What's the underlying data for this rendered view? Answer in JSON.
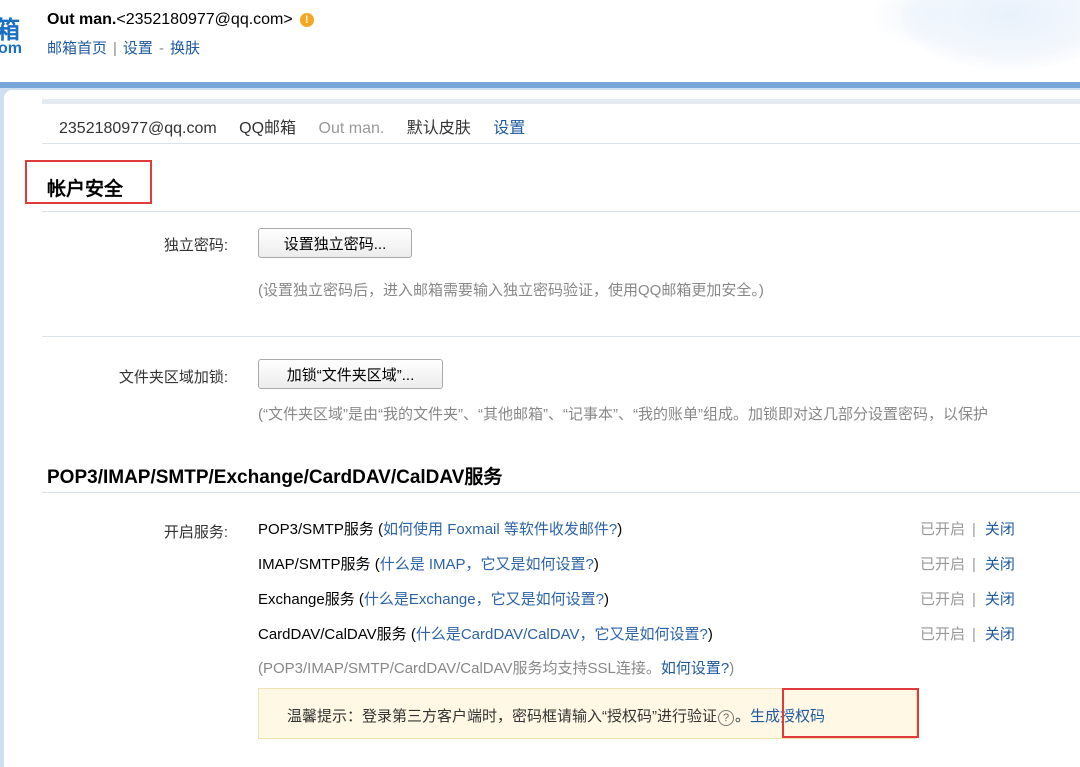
{
  "header": {
    "logo_char": "箱",
    "logo_suffix": "om",
    "user_name": "Out man.",
    "user_email": "<2352180977@qq.com>",
    "warning_icon": "!",
    "links": [
      "邮箱首页",
      "设置",
      "换肤"
    ],
    "sep1": "|",
    "sep2": "-"
  },
  "account": {
    "email": "2352180977@qq.com",
    "mailbox": "QQ邮箱",
    "nickname": "Out man.",
    "skin": "默认皮肤",
    "settings": "设置"
  },
  "security": {
    "title": "帐户安全",
    "password_label": "独立密码:",
    "password_button": "设置独立密码...",
    "password_hint": "(设置独立密码后，进入邮箱需要输入独立密码验证，使用QQ邮箱更加安全。)",
    "folder_label": "文件夹区域加锁:",
    "folder_button": "加锁“文件夹区域”...",
    "folder_hint": "(“文件夹区域”是由“我的文件夹”、“其他邮箱”、“记事本”、“我的账单”组成。加锁即对这几部分设置密码，以保护"
  },
  "services": {
    "title": "POP3/IMAP/SMTP/Exchange/CardDAV/CalDAV服务",
    "label": "开启服务:",
    "items": [
      {
        "name": "POP3/SMTP服务",
        "open": "(",
        "help": "如何使用 Foxmail 等软件收发邮件?",
        "close": ")",
        "status": "已开启",
        "sep": "|",
        "action": "关闭"
      },
      {
        "name": "IMAP/SMTP服务",
        "open": "(",
        "help": "什么是 IMAP，它又是如何设置?",
        "close": ")",
        "status": "已开启",
        "sep": "|",
        "action": "关闭"
      },
      {
        "name": "Exchange服务",
        "open": "(",
        "help": "什么是Exchange，它又是如何设置?",
        "close": ")",
        "status": "已开启",
        "sep": "|",
        "action": "关闭"
      },
      {
        "name": "CardDAV/CalDAV服务",
        "open": "(",
        "help": "什么是CardDAV/CalDAV，它又是如何设置?",
        "close": ")",
        "status": "已开启",
        "sep": "|",
        "action": "关闭"
      }
    ],
    "ssl_note": "(POP3/IMAP/SMTP/CardDAV/CalDAV服务均支持SSL连接。",
    "ssl_link": "如何设置?",
    "ssl_close": ")",
    "tip": "温馨提示：登录第三方客户端时，密码框请输入“授权码”进行验证",
    "tip_icon": "?",
    "tip_period": "。",
    "generate_code": "生成授权码"
  },
  "colors": {
    "link": "#1e5a9e",
    "highlight_border": "#e03a3a",
    "tip_background": "#fff8e4"
  }
}
